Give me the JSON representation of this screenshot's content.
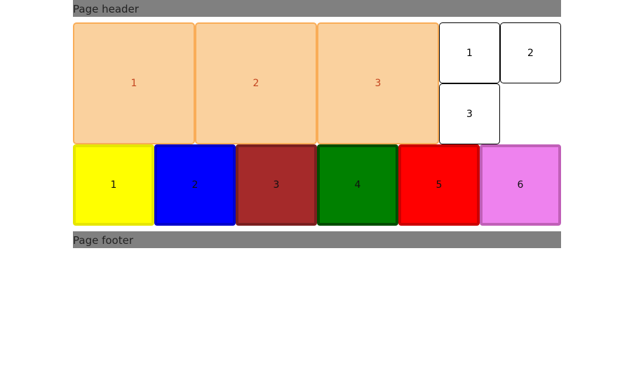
{
  "header": {
    "label": "Page header"
  },
  "footer": {
    "label": "Page footer"
  },
  "large_items": [
    "1",
    "2",
    "3"
  ],
  "small_items": [
    "1",
    "2",
    "3"
  ],
  "color_items": [
    {
      "label": "1",
      "bg": "#ffff00",
      "border": "#e6e600"
    },
    {
      "label": "2",
      "bg": "#0000ff",
      "border": "#0000cc"
    },
    {
      "label": "3",
      "bg": "#a52a2a",
      "border": "#7a1f1f"
    },
    {
      "label": "4",
      "bg": "#008000",
      "border": "#004d00"
    },
    {
      "label": "5",
      "bg": "#ff0000",
      "border": "#cc0000"
    },
    {
      "label": "6",
      "bg": "#ee82ee",
      "border": "#c060b8"
    }
  ]
}
